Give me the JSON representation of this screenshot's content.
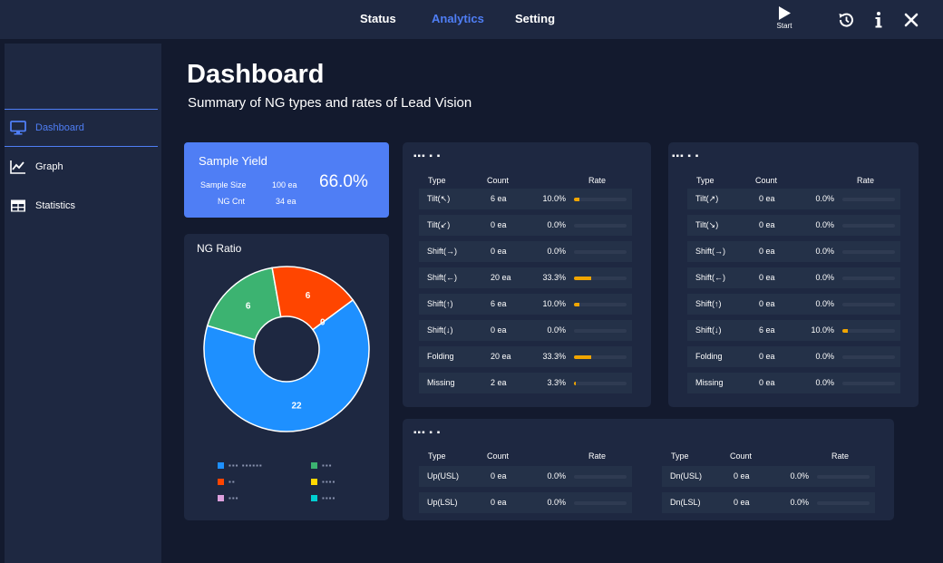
{
  "topnav": {
    "items": [
      {
        "label": "Status",
        "active": false
      },
      {
        "label": "Analytics",
        "active": true
      },
      {
        "label": "Setting",
        "active": false
      }
    ],
    "start_label": "Start",
    "icons": [
      "history-icon",
      "info-icon",
      "close-icon"
    ]
  },
  "sidebar": {
    "items": [
      {
        "label": "Dashboard",
        "icon": "monitor-icon",
        "active": true
      },
      {
        "label": "Graph",
        "icon": "line-chart-icon",
        "active": false
      },
      {
        "label": "Statistics",
        "icon": "table-icon",
        "active": false
      }
    ]
  },
  "header": {
    "title": "Dashboard",
    "subtitle": "Summary of NG types and rates of Lead Vision"
  },
  "yield": {
    "title": "Sample Yield",
    "sample_size_label": "Sample Size",
    "sample_size_value": "100 ea",
    "ng_cnt_label": "NG Cnt",
    "ng_cnt_value": "34 ea",
    "yield_value": "66.0%"
  },
  "ng_ratio": {
    "title": "NG Ratio",
    "legend": [
      {
        "text": "▪▪▪ ▪▪▪▪▪▪",
        "color": "#1e90ff"
      },
      {
        "text": "▪▪▪",
        "color": "#3cb371"
      },
      {
        "text": "▪▪",
        "color": "#ff4500"
      },
      {
        "text": "▪▪▪▪",
        "color": "#ffd700"
      },
      {
        "text": "▪▪▪",
        "color": "#dda0dd"
      },
      {
        "text": "▪▪▪▪",
        "color": "#00ced1"
      }
    ]
  },
  "chart_data": {
    "type": "pie",
    "title": "NG Ratio",
    "donut": true,
    "slices": [
      {
        "value": 22,
        "color": "#1e90ff",
        "label": "22"
      },
      {
        "value": 6,
        "color": "#3cb371",
        "label": "6"
      },
      {
        "value": 6,
        "color": "#ff4500",
        "label": "6"
      },
      {
        "value": 0,
        "color": "#ffd700",
        "label": "0"
      }
    ]
  },
  "table1": {
    "title": "▪▪▪ ▪ ▪",
    "headers": [
      "Type",
      "Count",
      "Rate"
    ],
    "rows": [
      {
        "type": "Tilt(↖)",
        "count": "6  ea",
        "rate": "10.0%",
        "pct": 10.0
      },
      {
        "type": "Tilt(↙)",
        "count": "0  ea",
        "rate": "0.0%",
        "pct": 0
      },
      {
        "type": "Shift(→)",
        "count": "0  ea",
        "rate": "0.0%",
        "pct": 0
      },
      {
        "type": "Shift(←)",
        "count": "20  ea",
        "rate": "33.3%",
        "pct": 33.3
      },
      {
        "type": "Shift(↑)",
        "count": "6  ea",
        "rate": "10.0%",
        "pct": 10.0
      },
      {
        "type": "Shift(↓)",
        "count": "0  ea",
        "rate": "0.0%",
        "pct": 0
      },
      {
        "type": "Folding",
        "count": "20  ea",
        "rate": "33.3%",
        "pct": 33.3
      },
      {
        "type": "Missing",
        "count": "2  ea",
        "rate": "3.3%",
        "pct": 3.3
      }
    ]
  },
  "table2": {
    "title": "▪▪▪ ▪ ▪",
    "headers": [
      "Type",
      "Count",
      "Rate"
    ],
    "rows": [
      {
        "type": "Tilt(↗)",
        "count": "0  ea",
        "rate": "0.0%",
        "pct": 0
      },
      {
        "type": "Tilt(↘)",
        "count": "0  ea",
        "rate": "0.0%",
        "pct": 0
      },
      {
        "type": "Shift(→)",
        "count": "0  ea",
        "rate": "0.0%",
        "pct": 0
      },
      {
        "type": "Shift(←)",
        "count": "0  ea",
        "rate": "0.0%",
        "pct": 0
      },
      {
        "type": "Shift(↑)",
        "count": "0  ea",
        "rate": "0.0%",
        "pct": 0
      },
      {
        "type": "Shift(↓)",
        "count": "6  ea",
        "rate": "10.0%",
        "pct": 10.0
      },
      {
        "type": "Folding",
        "count": "0  ea",
        "rate": "0.0%",
        "pct": 0
      },
      {
        "type": "Missing",
        "count": "0  ea",
        "rate": "0.0%",
        "pct": 0
      }
    ]
  },
  "table3": {
    "title": "▪▪▪ ▪ ▪",
    "left": {
      "headers": [
        "Type",
        "Count",
        "Rate"
      ],
      "rows": [
        {
          "type": "Up(USL)",
          "count": "0  ea",
          "rate": "0.0%",
          "pct": 0
        },
        {
          "type": "Up(LSL)",
          "count": "0  ea",
          "rate": "0.0%",
          "pct": 0
        }
      ]
    },
    "right": {
      "headers": [
        "Type",
        "Count",
        "Rate"
      ],
      "rows": [
        {
          "type": "Dn(USL)",
          "count": "0  ea",
          "rate": "0.0%",
          "pct": 0
        },
        {
          "type": "Dn(LSL)",
          "count": "0  ea",
          "rate": "0.0%",
          "pct": 0
        }
      ]
    }
  }
}
